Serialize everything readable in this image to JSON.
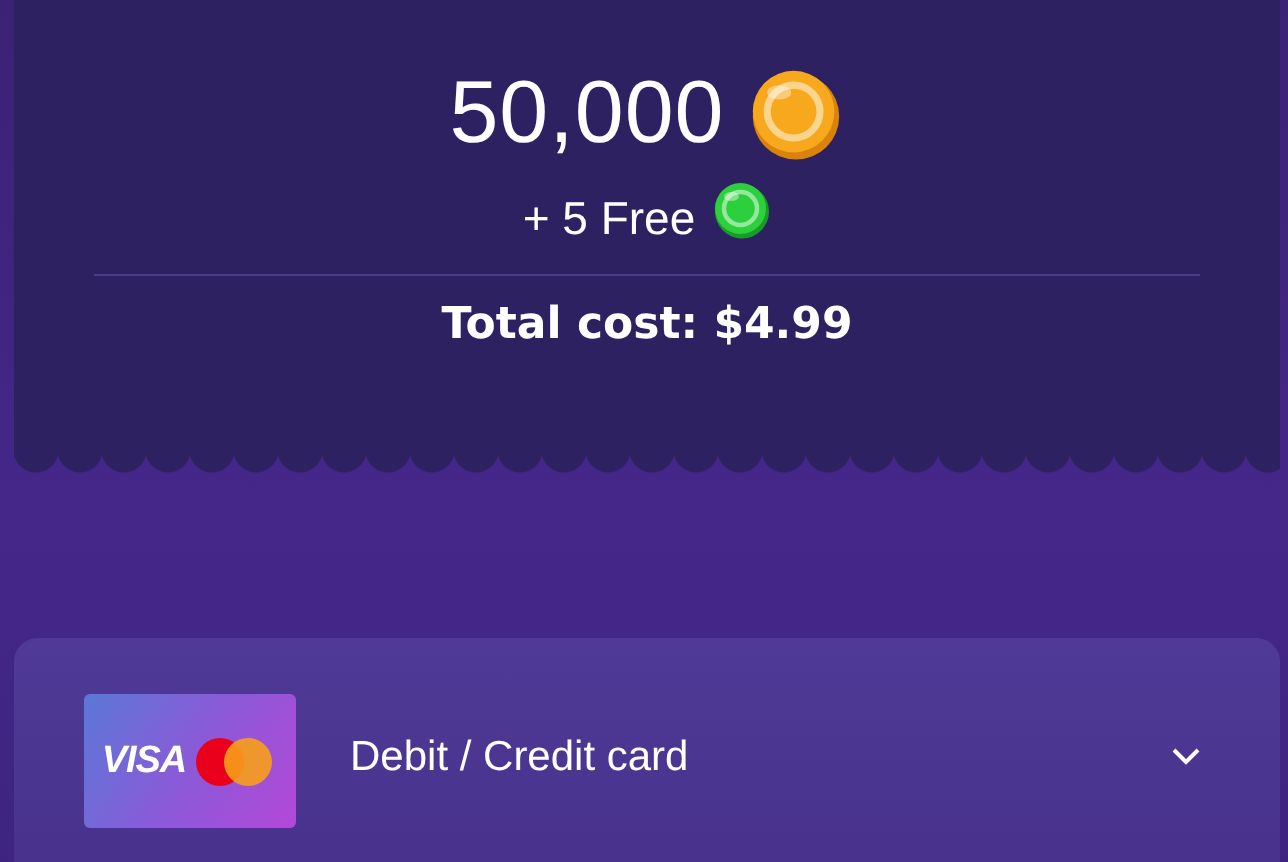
{
  "summary": {
    "amount": "50,000",
    "bonus": "+ 5 Free",
    "total": "Total cost: $4.99"
  },
  "payment_method": {
    "logo_text": "VISA",
    "label": "Debit / Credit card",
    "expanded": false
  }
}
